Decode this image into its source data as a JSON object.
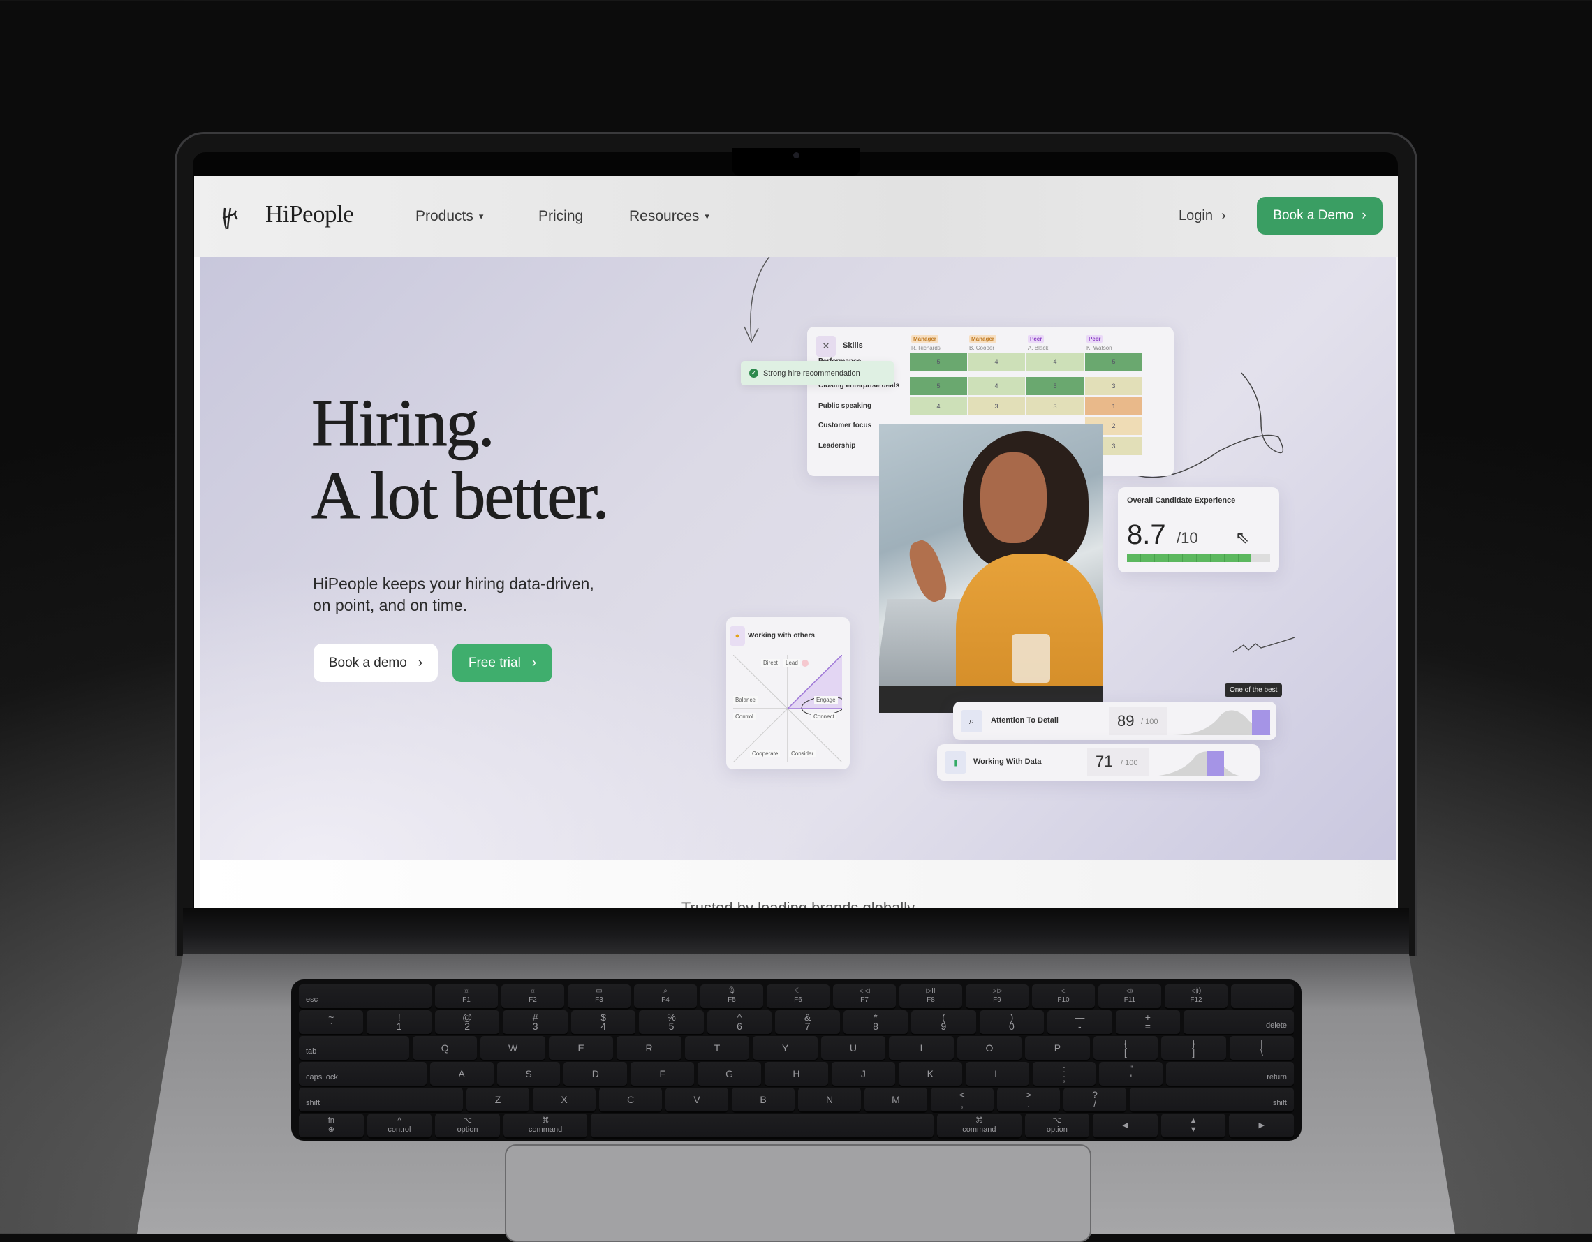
{
  "nav": {
    "logo": "HiPeople",
    "items": [
      {
        "label": "Products",
        "has_dropdown": true
      },
      {
        "label": "Pricing",
        "has_dropdown": false
      },
      {
        "label": "Resources",
        "has_dropdown": true
      }
    ],
    "login": "Login",
    "cta": "Book a Demo",
    "chevron": "›",
    "caret": "▾"
  },
  "hero": {
    "title_line1": "Hiring.",
    "title_line2": "A lot better.",
    "subtitle_line1": "HiPeople keeps your hiring data-driven,",
    "subtitle_line2": "on point, and on time.",
    "book_demo": "Book a demo",
    "free_trial": "Free trial"
  },
  "skills_card": {
    "title": "Skills",
    "icon": "tools-icon",
    "reviewers": [
      {
        "role": "Manager",
        "name": "R. Richards"
      },
      {
        "role": "Manager",
        "name": "B. Cooper"
      },
      {
        "role": "Peer",
        "name": "A. Black"
      },
      {
        "role": "Peer",
        "name": "K. Watson"
      }
    ],
    "rows": [
      {
        "label": "Performance",
        "scores": [
          "5",
          "4",
          "4",
          "5"
        ]
      },
      {
        "label": "Closing enterprise deals",
        "scores": [
          "5",
          "4",
          "5",
          "3"
        ]
      },
      {
        "label": "Public speaking",
        "scores": [
          "4",
          "3",
          "3",
          "1"
        ]
      },
      {
        "label": "Customer focus",
        "scores": [
          "",
          "",
          "",
          "2"
        ]
      },
      {
        "label": "Leadership",
        "scores": [
          "",
          "",
          "",
          "3"
        ]
      }
    ]
  },
  "recommendation": {
    "label": "Strong hire recommendation"
  },
  "experience_card": {
    "title": "Overall Candidate Experience",
    "score": "8.7",
    "max": "/10",
    "fill_fraction": 0.87
  },
  "working_with_others": {
    "title": "Working with others",
    "labels": {
      "direct": "Direct",
      "lead": "Lead",
      "balance": "Balance",
      "engage": "Engage",
      "control": "Control",
      "connect": "Connect",
      "cooperate": "Cooperate",
      "consider": "Consider"
    }
  },
  "metrics": [
    {
      "label": "Attention To Detail",
      "score": "89",
      "max": "/ 100",
      "icon": "magnifier-icon"
    },
    {
      "label": "Working With Data",
      "score": "71",
      "max": "/ 100",
      "icon": "bar-chart-icon"
    }
  ],
  "tooltip": "One of the best",
  "trusted": "Trusted by leading brands globally",
  "colors": {
    "green": "#3a9e63",
    "cell_high": "#6aa86f",
    "cell_mid": "#cde0b8",
    "cell_low": "#e2dfb8",
    "cell_poor": "#e9b98a",
    "accent_purple": "#a594e6"
  },
  "keyboard": [
    [
      "esc",
      "☼\nF1",
      "☼\nF2",
      "▭\nF3",
      "⌕\nF4",
      "🎙\nF5",
      "☾\nF6",
      "◁◁\nF7",
      "▷II\nF8",
      "▷▷\nF9",
      "◁\nF10",
      "◁›\nF11",
      "◁))\nF12",
      ""
    ],
    [
      "~\n`",
      "!\n1",
      "@\n2",
      "#\n3",
      "$\n4",
      "%\n5",
      "^\n6",
      "&\n7",
      "*\n8",
      "(\n9",
      ")\n0",
      "—\n-",
      "+\n=",
      "delete"
    ],
    [
      "tab",
      "Q",
      "W",
      "E",
      "R",
      "T",
      "Y",
      "U",
      "I",
      "O",
      "P",
      "{\n[",
      "}\n]",
      "|\n\\"
    ],
    [
      "caps lock",
      "A",
      "S",
      "D",
      "F",
      "G",
      "H",
      "J",
      "K",
      "L",
      ":\n;",
      "\"\n'",
      "return"
    ],
    [
      "shift",
      "Z",
      "X",
      "C",
      "V",
      "B",
      "N",
      "M",
      "<\n,",
      ">\n.",
      "?\n/",
      "shift"
    ],
    [
      "fn\n⊕",
      "^\ncontrol",
      "⌥\noption",
      "⌘\ncommand",
      "",
      "⌘\ncommand",
      "⌥\noption",
      "◀",
      "▲\n▼",
      "▶"
    ]
  ]
}
